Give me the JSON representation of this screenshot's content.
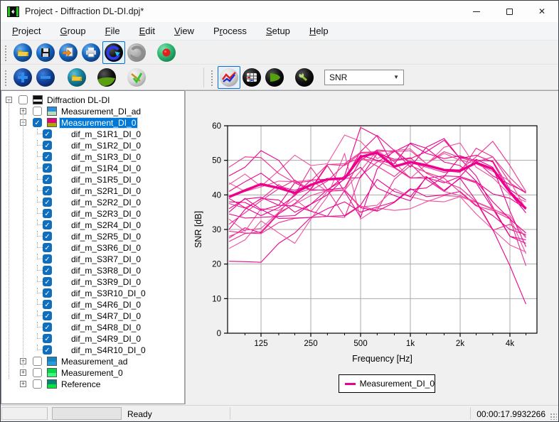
{
  "window": {
    "title": "Project - Diffraction DL-DI.dpj*"
  },
  "menu": {
    "items": [
      {
        "label": "Project",
        "accel": 0
      },
      {
        "label": "Group",
        "accel": 0
      },
      {
        "label": "File",
        "accel": 0
      },
      {
        "label": "Edit",
        "accel": 0
      },
      {
        "label": "View",
        "accel": 0
      },
      {
        "label": "Process",
        "accel": 1
      },
      {
        "label": "Setup",
        "accel": 0
      },
      {
        "label": "Help",
        "accel": 0
      }
    ]
  },
  "toolbar": {
    "analysis_selector": {
      "value": "SNR"
    }
  },
  "tree": {
    "nodes": [
      {
        "label": "Diffraction DL-DI",
        "level": 0,
        "expand": "minus",
        "checked": false,
        "selected": false,
        "icon": {
          "top": "#111111",
          "bottom": "#111111",
          "stripe": "#ffffff"
        }
      },
      {
        "label": "Measurement_DI_ad",
        "level": 1,
        "expand": "plus",
        "checked": false,
        "selected": false,
        "icon": {
          "top": "#2a8fe0",
          "bottom": "#b9ddb4"
        }
      },
      {
        "label": "Measurement_DI_0",
        "level": 1,
        "expand": "minus",
        "checked": true,
        "selected": true,
        "icon": {
          "top": "#e6007e",
          "bottom": "#a8a800"
        }
      },
      {
        "label": "dif_m_S1R1_DI_0",
        "level": 2,
        "expand": "none",
        "checked": true,
        "selected": false,
        "icon": null
      },
      {
        "label": "dif_m_S1R2_DI_0",
        "level": 2,
        "expand": "none",
        "checked": true,
        "selected": false,
        "icon": null
      },
      {
        "label": "dif_m_S1R3_DI_0",
        "level": 2,
        "expand": "none",
        "checked": true,
        "selected": false,
        "icon": null
      },
      {
        "label": "dif_m_S1R4_DI_0",
        "level": 2,
        "expand": "none",
        "checked": true,
        "selected": false,
        "icon": null
      },
      {
        "label": "dif_m_S1R5_DI_0",
        "level": 2,
        "expand": "none",
        "checked": true,
        "selected": false,
        "icon": null
      },
      {
        "label": "dif_m_S2R1_DI_0",
        "level": 2,
        "expand": "none",
        "checked": true,
        "selected": false,
        "icon": null
      },
      {
        "label": "dif_m_S2R2_DI_0",
        "level": 2,
        "expand": "none",
        "checked": true,
        "selected": false,
        "icon": null
      },
      {
        "label": "dif_m_S2R3_DI_0",
        "level": 2,
        "expand": "none",
        "checked": true,
        "selected": false,
        "icon": null
      },
      {
        "label": "dif_m_S2R4_DI_0",
        "level": 2,
        "expand": "none",
        "checked": true,
        "selected": false,
        "icon": null
      },
      {
        "label": "dif_m_S2R5_DI_0",
        "level": 2,
        "expand": "none",
        "checked": true,
        "selected": false,
        "icon": null
      },
      {
        "label": "dif_m_S3R6_DI_0",
        "level": 2,
        "expand": "none",
        "checked": true,
        "selected": false,
        "icon": null
      },
      {
        "label": "dif_m_S3R7_DI_0",
        "level": 2,
        "expand": "none",
        "checked": true,
        "selected": false,
        "icon": null
      },
      {
        "label": "dif_m_S3R8_DI_0",
        "level": 2,
        "expand": "none",
        "checked": true,
        "selected": false,
        "icon": null
      },
      {
        "label": "dif_m_S3R9_DI_0",
        "level": 2,
        "expand": "none",
        "checked": true,
        "selected": false,
        "icon": null
      },
      {
        "label": "dif_m_S3R10_DI_0",
        "level": 2,
        "expand": "none",
        "checked": true,
        "selected": false,
        "icon": null
      },
      {
        "label": "dif_m_S4R6_DI_0",
        "level": 2,
        "expand": "none",
        "checked": true,
        "selected": false,
        "icon": null
      },
      {
        "label": "dif_m_S4R7_DI_0",
        "level": 2,
        "expand": "none",
        "checked": true,
        "selected": false,
        "icon": null
      },
      {
        "label": "dif_m_S4R8_DI_0",
        "level": 2,
        "expand": "none",
        "checked": true,
        "selected": false,
        "icon": null
      },
      {
        "label": "dif_m_S4R9_DI_0",
        "level": 2,
        "expand": "none",
        "checked": true,
        "selected": false,
        "icon": null
      },
      {
        "label": "dif_m_S4R10_DI_0",
        "level": 2,
        "expand": "none",
        "checked": true,
        "selected": false,
        "icon": null
      },
      {
        "label": "Measurement_ad",
        "level": 1,
        "expand": "plus",
        "checked": false,
        "selected": false,
        "icon": {
          "top": "#0e86c8",
          "bottom": "#2a9ad8"
        }
      },
      {
        "label": "Measurement_0",
        "level": 1,
        "expand": "plus",
        "checked": false,
        "selected": false,
        "icon": {
          "top": "#00d844",
          "bottom": "#3cf87c"
        }
      },
      {
        "label": "Reference",
        "level": 1,
        "expand": "plus",
        "checked": false,
        "selected": false,
        "icon": {
          "top": "#008878",
          "bottom": "#00e83c"
        }
      }
    ]
  },
  "chart_data": {
    "type": "line",
    "title": "",
    "xlabel": "Frequency [Hz]",
    "ylabel": "SNR [dB]",
    "x_scale": "log",
    "ylim": [
      0,
      60
    ],
    "yticks": [
      0,
      10,
      20,
      30,
      40,
      50,
      60
    ],
    "xticks": [
      {
        "v": 125,
        "label": "125"
      },
      {
        "v": 250,
        "label": "250"
      },
      {
        "v": 500,
        "label": "500"
      },
      {
        "v": 1000,
        "label": "1k"
      },
      {
        "v": 2000,
        "label": "2k"
      },
      {
        "v": 4000,
        "label": "4k"
      }
    ],
    "grid": true,
    "legend": "Measurement_DI_0",
    "legend_position": "bottom",
    "frequencies": [
      80,
      100,
      125,
      160,
      200,
      250,
      315,
      400,
      500,
      630,
      800,
      1000,
      1250,
      1600,
      2000,
      2500,
      3150,
      4000,
      5000
    ],
    "mean_series": {
      "name": "Measurement_DI_0",
      "color": "#ec008c",
      "width": 3.4,
      "values": [
        39.4,
        41.3,
        43.1,
        42.0,
        40.6,
        42.9,
        44.5,
        44.8,
        51.0,
        52.2,
        48.2,
        49.5,
        48.6,
        47.2,
        47.0,
        49.3,
        47.5,
        40.8,
        36.0
      ]
    },
    "series": [
      {
        "name": "dif_m_S1R1_DI_0",
        "color": "#ec008c",
        "values": [
          20.8,
          20.7,
          20.5,
          26.0,
          29.0,
          33.5,
          36.0,
          38.0,
          35.0,
          36.5,
          38.0,
          41.8,
          39.5,
          40.0,
          41.0,
          37.0,
          34.0,
          30.0,
          28.5
        ]
      },
      {
        "name": "dif_m_S1R2_DI_0",
        "color": "#f0509e",
        "values": [
          24.5,
          27.0,
          32.5,
          29.0,
          26.0,
          33.0,
          39.5,
          52.0,
          33.0,
          36.2,
          35.5,
          36.0,
          38.0,
          39.8,
          39.5,
          34.5,
          30.0,
          25.5,
          23.5
        ]
      },
      {
        "name": "dif_m_S1R3_DI_0",
        "color": "#ec008c",
        "values": [
          27.5,
          30.5,
          29.0,
          34.5,
          37.5,
          41.5,
          48.5,
          41.0,
          33.5,
          47.5,
          53.0,
          49.0,
          44.5,
          41.0,
          45.0,
          43.5,
          36.0,
          28.0,
          27.0
        ]
      },
      {
        "name": "dif_m_S1R4_DI_0",
        "color": "#ee2d92",
        "values": [
          29.5,
          29.0,
          28.8,
          32.0,
          33.2,
          33.5,
          33.8,
          33.5,
          45.5,
          49.5,
          52.5,
          52.8,
          49.0,
          52.5,
          50.8,
          49.5,
          51.0,
          43.5,
          40.5
        ]
      },
      {
        "name": "dif_m_S1R5_DI_0",
        "color": "#ec008c",
        "values": [
          30.0,
          35.8,
          39.0,
          38.5,
          35.0,
          37.3,
          41.5,
          44.5,
          52.5,
          57.2,
          52.8,
          48.0,
          53.8,
          56.3,
          50.5,
          45.5,
          36.5,
          28.0,
          26.0
        ]
      },
      {
        "name": "dif_m_S2R1_DI_0",
        "color": "#f0509e",
        "values": [
          33.0,
          29.5,
          36.0,
          35.5,
          38.8,
          35.2,
          41.0,
          41.3,
          47.0,
          52.8,
          49.5,
          44.8,
          45.3,
          41.0,
          39.8,
          38.0,
          36.0,
          33.5,
          23.0
        ]
      },
      {
        "name": "dif_m_S2R2_DI_0",
        "color": "#ec008c",
        "values": [
          35.0,
          39.0,
          35.8,
          33.2,
          33.3,
          33.5,
          33.8,
          41.3,
          36.3,
          35.3,
          37.8,
          41.5,
          42.0,
          45.3,
          51.0,
          50.0,
          49.8,
          41.5,
          38.5
        ]
      },
      {
        "name": "dif_m_S2R3_DI_0",
        "color": "#ee2d92",
        "values": [
          37.5,
          36.2,
          38.8,
          43.0,
          40.0,
          48.0,
          41.5,
          33.8,
          36.8,
          35.5,
          44.5,
          48.5,
          46.5,
          44.8,
          40.8,
          36.8,
          35.5,
          33.0,
          19.5
        ]
      },
      {
        "name": "dif_m_S2R4_DI_0",
        "color": "#ec008c",
        "values": [
          38.0,
          37.8,
          35.5,
          37.0,
          43.5,
          41.3,
          41.5,
          42.0,
          50.0,
          53.0,
          52.5,
          54.8,
          52.0,
          50.5,
          51.3,
          49.8,
          45.5,
          43.0,
          40.8
        ]
      },
      {
        "name": "dif_m_S2R5_DI_0",
        "color": "#f0509e",
        "values": [
          43.0,
          46.0,
          42.5,
          47.0,
          51.5,
          48.5,
          49.0,
          57.3,
          55.5,
          50.5,
          52.8,
          53.3,
          49.0,
          52.0,
          50.0,
          49.0,
          46.8,
          44.0,
          35.8
        ]
      },
      {
        "name": "dif_m_S3R6_DI_0",
        "color": "#ec008c",
        "values": [
          45.5,
          48.0,
          52.8,
          50.0,
          44.0,
          41.5,
          41.3,
          45.5,
          59.5,
          57.0,
          48.0,
          45.0,
          44.8,
          45.5,
          45.3,
          43.8,
          40.3,
          39.0,
          36.0
        ]
      },
      {
        "name": "dif_m_S3R7_DI_0",
        "color": "#ee2d92",
        "values": [
          48.0,
          51.0,
          50.8,
          46.2,
          43.5,
          44.0,
          48.8,
          49.0,
          52.3,
          52.5,
          52.8,
          49.5,
          48.3,
          47.0,
          46.5,
          53.5,
          51.0,
          45.0,
          40.5
        ]
      },
      {
        "name": "dif_m_S3R8_DI_0",
        "color": "#f0509e",
        "values": [
          28.0,
          29.8,
          30.3,
          35.0,
          37.3,
          39.8,
          41.3,
          41.5,
          36.5,
          37.0,
          41.8,
          39.5,
          38.3,
          38.0,
          39.5,
          37.8,
          35.8,
          34.0,
          27.5
        ]
      },
      {
        "name": "dif_m_S3R9_DI_0",
        "color": "#ec008c",
        "values": [
          36.0,
          38.8,
          39.3,
          37.0,
          36.8,
          35.3,
          33.8,
          34.0,
          37.0,
          44.5,
          41.0,
          39.5,
          45.0,
          43.5,
          45.3,
          50.3,
          48.0,
          35.3,
          25.0
        ]
      },
      {
        "name": "dif_m_S3R10_DI_0",
        "color": "#ee2d92",
        "values": [
          26.5,
          28.8,
          29.3,
          34.8,
          40.3,
          41.8,
          48.8,
          48.5,
          52.0,
          52.3,
          49.8,
          50.8,
          46.3,
          43.8,
          42.0,
          38.0,
          29.8,
          31.5,
          28.0
        ]
      },
      {
        "name": "dif_m_S4R6_DI_0",
        "color": "#ec008c",
        "values": [
          39.0,
          36.3,
          34.0,
          36.3,
          39.8,
          44.3,
          44.5,
          44.8,
          45.0,
          52.0,
          50.3,
          50.5,
          52.5,
          55.8,
          50.5,
          51.5,
          49.5,
          40.5,
          34.8
        ]
      },
      {
        "name": "dif_m_S4R7_DI_0",
        "color": "#f0509e",
        "values": [
          43.5,
          41.0,
          42.3,
          44.0,
          43.8,
          44.3,
          41.0,
          41.3,
          50.5,
          49.8,
          47.8,
          44.8,
          48.8,
          53.8,
          55.0,
          48.0,
          45.0,
          40.0,
          38.0
        ]
      },
      {
        "name": "dif_m_S4R8_DI_0",
        "color": "#ec008c",
        "values": [
          34.5,
          33.3,
          33.5,
          33.8,
          34.0,
          37.3,
          40.0,
          44.8,
          48.0,
          42.0,
          39.8,
          38.3,
          45.3,
          41.3,
          44.8,
          38.3,
          30.0,
          19.5,
          8.4
        ]
      },
      {
        "name": "dif_m_S4R9_DI_0",
        "color": "#ee2d92",
        "values": [
          31.5,
          34.8,
          38.3,
          41.8,
          44.3,
          41.3,
          44.0,
          48.8,
          50.8,
          48.3,
          45.3,
          49.3,
          48.0,
          46.5,
          47.3,
          51.0,
          55.5,
          48.5,
          41.0
        ]
      },
      {
        "name": "dif_m_S4R10_DI_0",
        "color": "#ec008c",
        "values": [
          41.0,
          43.8,
          46.3,
          42.5,
          41.3,
          43.0,
          44.5,
          45.0,
          51.5,
          50.0,
          49.0,
          55.0,
          53.5,
          49.5,
          48.5,
          44.0,
          38.0,
          33.0,
          29.0
        ]
      }
    ]
  },
  "status": {
    "ready": "Ready",
    "time": "00:00:17.9932266"
  }
}
